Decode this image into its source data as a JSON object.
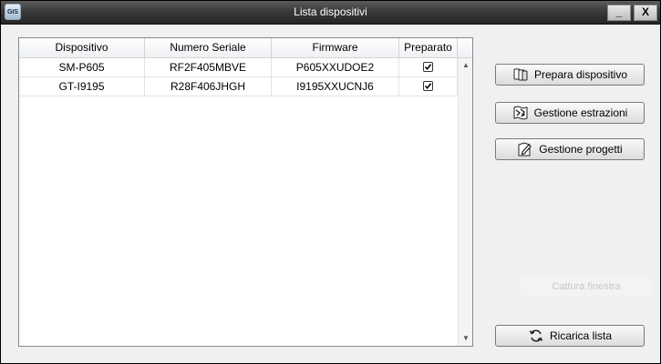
{
  "window": {
    "title": "Lista dispositivi",
    "app_icon_text": "GIS",
    "minimize_symbol": "_",
    "close_symbol": "X"
  },
  "table": {
    "columns": [
      "Dispositivo",
      "Numero Seriale",
      "Firmware",
      "Preparato"
    ],
    "rows": [
      {
        "dispositivo": "SM-P605",
        "numero_seriale": "RF2F405MBVE",
        "firmware": "P605XXUDOE2",
        "preparato": true
      },
      {
        "dispositivo": "GT-I9195",
        "numero_seriale": "R28F406JHGH",
        "firmware": "I9195XXUCNJ6",
        "preparato": true
      }
    ]
  },
  "buttons": {
    "prepara": {
      "label": "Prepara dispositivo",
      "icon": "devices-icon"
    },
    "estrazioni": {
      "label": "Gestione estrazioni",
      "icon": "extractions-icon"
    },
    "progetti": {
      "label": "Gestione progetti",
      "icon": "edit-project-icon"
    },
    "cattura": {
      "label": "Cattura finestra"
    },
    "ricarica": {
      "label": "Ricarica lista",
      "icon": "refresh-icon"
    }
  },
  "colors": {
    "titlebar": "#3a3a3a",
    "window_bg": "#f0f0f0",
    "disabled_text": "#c8c8c8"
  }
}
